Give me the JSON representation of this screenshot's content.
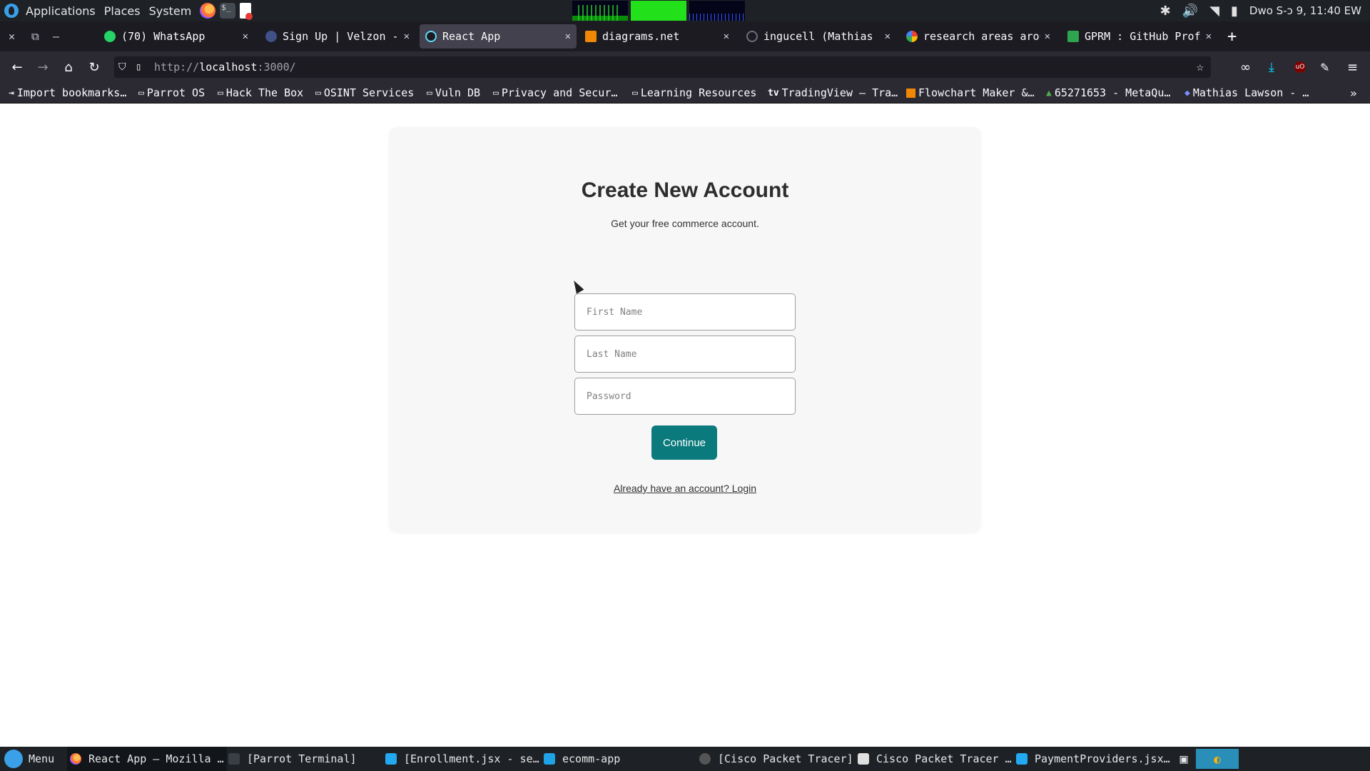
{
  "os_panel": {
    "menus": [
      "Applications",
      "Places",
      "System"
    ],
    "clock": "Dwo S-ɔ 9, 11:40 EW",
    "tray_icons": [
      "bluetooth-icon",
      "volume-icon",
      "wifi-icon",
      "battery-icon"
    ]
  },
  "browser": {
    "tabs": [
      {
        "title": "(70) WhatsApp",
        "icon": "whatsapp-icon",
        "active": false
      },
      {
        "title": "Sign Up | Velzon - ",
        "icon": "velzon-icon",
        "active": false
      },
      {
        "title": "React App",
        "icon": "react-icon",
        "active": true
      },
      {
        "title": "diagrams.net",
        "icon": "drawio-icon",
        "active": false
      },
      {
        "title": "ingucell (Mathias L",
        "icon": "github-icon",
        "active": false
      },
      {
        "title": "research areas arou",
        "icon": "google-icon",
        "active": false
      },
      {
        "title": "GPRM : GitHub Profi",
        "icon": "gprm-icon",
        "active": false
      }
    ],
    "url_scheme": "http://",
    "url_host": "localhost",
    "url_rest": ":3000/",
    "bookmarks": [
      {
        "label": "Import bookmarks…",
        "icon": "import-icon"
      },
      {
        "label": "Parrot OS",
        "icon": "folder-icon"
      },
      {
        "label": "Hack The Box",
        "icon": "folder-icon"
      },
      {
        "label": "OSINT Services",
        "icon": "folder-icon"
      },
      {
        "label": "Vuln DB",
        "icon": "folder-icon"
      },
      {
        "label": "Privacy and Secur…",
        "icon": "folder-icon"
      },
      {
        "label": "Learning Resources",
        "icon": "folder-icon"
      },
      {
        "label": "TradingView – Tra…",
        "icon": "tradingview-icon"
      },
      {
        "label": "Flowchart Maker &…",
        "icon": "drawio-icon"
      },
      {
        "label": "65271653 - MetaQu…",
        "icon": "metaquotes-icon"
      },
      {
        "label": "Mathias Lawson - …",
        "icon": "profile-icon"
      }
    ]
  },
  "signup": {
    "title": "Create New Account",
    "subtitle": "Get your free commerce account.",
    "first_name_placeholder": "First Name",
    "last_name_placeholder": "Last Name",
    "password_placeholder": "Password",
    "continue_label": "Continue",
    "login_link": "Already have an account? Login"
  },
  "taskbar": {
    "menu_label": "Menu",
    "items": [
      {
        "label": "React App — Mozilla …",
        "icon": "firefox-icon",
        "active": true
      },
      {
        "label": "[Parrot Terminal]",
        "icon": "terminal-icon",
        "active": false
      },
      {
        "label": "[Enrollment.jsx - se…",
        "icon": "vscode-icon",
        "active": false
      },
      {
        "label": "ecomm-app",
        "icon": "folder-icon",
        "active": false
      },
      {
        "label": "[Cisco Packet Tracer]",
        "icon": "packet-tracer-icon",
        "active": false
      },
      {
        "label": "Cisco Packet Tracer …",
        "icon": "window-icon",
        "active": false
      },
      {
        "label": "PaymentProviders.jsx…",
        "icon": "vscode-icon",
        "active": false
      }
    ]
  },
  "colors": {
    "accent": "#0b7a7d",
    "card_bg": "#f7f7f7",
    "browser_dark": "#1c1b22"
  }
}
